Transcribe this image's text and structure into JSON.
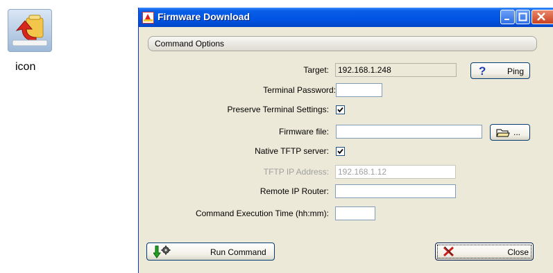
{
  "desktop": {
    "icon_caption": "icon"
  },
  "window": {
    "title": "Firmware Download"
  },
  "group": {
    "title": "Command Options"
  },
  "form": {
    "target_label": "Target:",
    "target_value": "192.168.1.248",
    "ping_label": "Ping",
    "terminal_password_label": "Terminal Password:",
    "terminal_password_value": "",
    "preserve_label": "Preserve Terminal Settings:",
    "preserve_checked": true,
    "firmware_file_label": "Firmware file:",
    "firmware_file_value": "",
    "browse_label": "...",
    "native_tftp_label": "Native TFTP server:",
    "native_tftp_checked": true,
    "tftp_ip_label": "TFTP IP Address:",
    "tftp_ip_value": "192.168.1.12",
    "remote_ip_label": "Remote IP Router:",
    "remote_ip_value": "",
    "exec_time_label": "Command Execution Time (hh:mm):",
    "exec_time_value": ""
  },
  "footer": {
    "run_label": "Run Command",
    "close_label": "Close"
  },
  "colors": {
    "titlebar": "#0054e3",
    "window_bg": "#ece9d8",
    "check": "#21a121"
  }
}
